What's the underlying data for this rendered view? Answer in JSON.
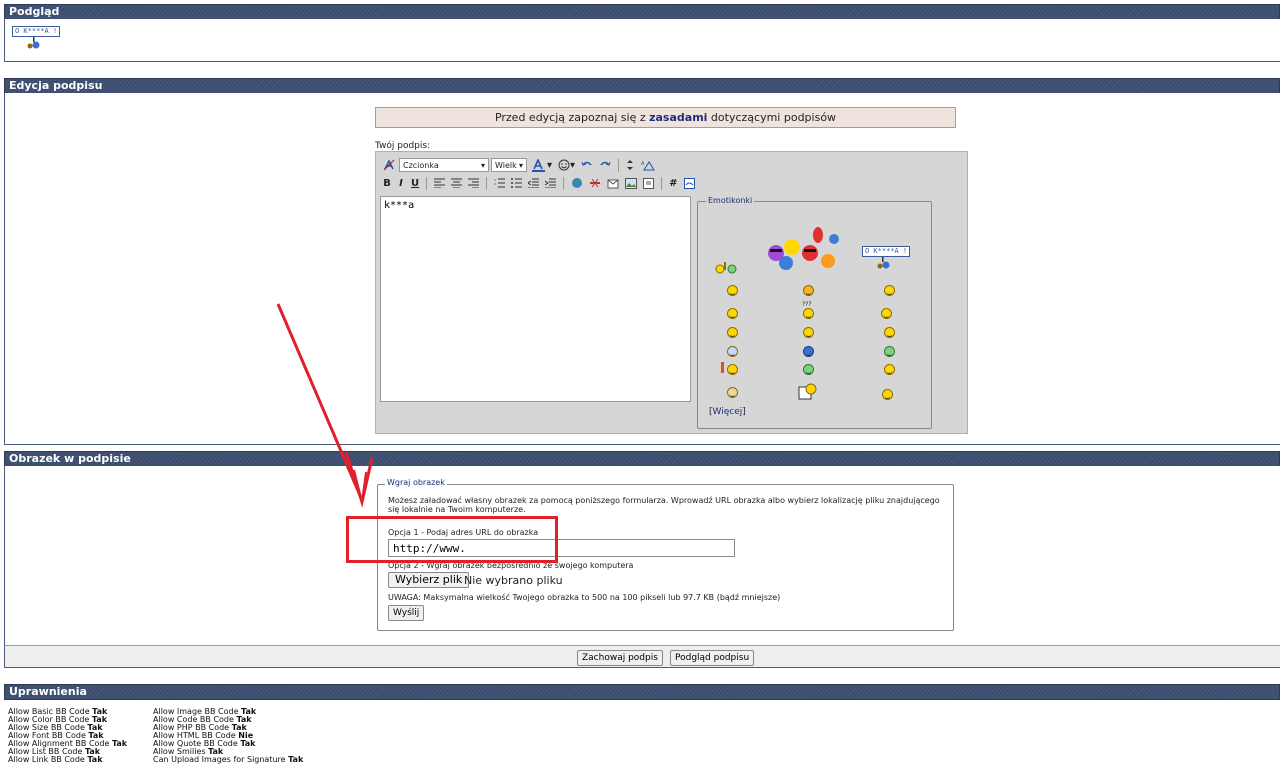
{
  "sections": {
    "preview": "Podgląd",
    "edit": "Edycja podpisu",
    "image": "Obrazek w podpisie",
    "permissions": "Uprawnienia"
  },
  "preview": {
    "sign_text": "O K****A !"
  },
  "rules": {
    "prefix": "Przed edycją zapoznaj się z ",
    "link": "zasadami",
    "suffix": " dotyczącymi podpisów"
  },
  "editor": {
    "label": "Twój podpis:",
    "font_select": "Czcionka",
    "size_select": "Wielk",
    "text": "k***a",
    "toolbar": {
      "bold": "B",
      "italic": "I",
      "underline": "U",
      "hash": "#"
    },
    "emoticons_legend": "Emotikonki",
    "more_prefix": "[",
    "more_link": "Więcej",
    "more_suffix": "]",
    "emo_sign_text": "O K****A !",
    "emo_qmark": "???"
  },
  "upload": {
    "legend": "Wgraj obrazek",
    "description": "Możesz załadować własny obrazek za pomocą poniższego formularza. Wprowadź URL obrazka albo wybierz lokalizację pliku znajdującego się lokalnie na Twoim komputerze.",
    "option1": "Opcja 1 - Podaj adres URL do obrazka",
    "url_value": "http://www.",
    "option2": "Opcja 2 - Wgraj obrazek bezpośrednio ze swojego komputera",
    "choose_file": "Wybierz plik",
    "no_file": "Nie wybrano pliku",
    "warning": "UWAGA: Maksymalna wielkość Twojego obrazka to 500 na 100 pikseli lub 97.7 KB (bądź mniejsze)",
    "send": "Wyślij"
  },
  "footer": {
    "save": "Zachowaj podpis",
    "preview": "Podgląd podpisu"
  },
  "permissions": {
    "col1": [
      {
        "label": "Allow Basic BB Code ",
        "value": "Tak"
      },
      {
        "label": "Allow Color BB Code ",
        "value": "Tak"
      },
      {
        "label": "Allow Size BB Code ",
        "value": "Tak"
      },
      {
        "label": "Allow Font BB Code ",
        "value": "Tak"
      },
      {
        "label": "Allow Alignment BB Code ",
        "value": "Tak"
      },
      {
        "label": "Allow List BB Code ",
        "value": "Tak"
      },
      {
        "label": "Allow Link BB Code ",
        "value": "Tak"
      }
    ],
    "col2": [
      {
        "label": "Allow Image BB Code ",
        "value": "Tak"
      },
      {
        "label": "Allow Code BB Code ",
        "value": "Tak"
      },
      {
        "label": "Allow PHP BB Code ",
        "value": "Tak"
      },
      {
        "label": "Allow HTML BB Code ",
        "value": "Nie"
      },
      {
        "label": "Allow Quote BB Code ",
        "value": "Tak"
      },
      {
        "label": "Allow Smilies ",
        "value": "Tak"
      },
      {
        "label": "Can Upload Images for Signature ",
        "value": "Tak"
      }
    ]
  },
  "colors": {
    "header_bar": "#3b4c6e",
    "annotation_red": "#e0202a",
    "link": "#1d2e7a"
  }
}
